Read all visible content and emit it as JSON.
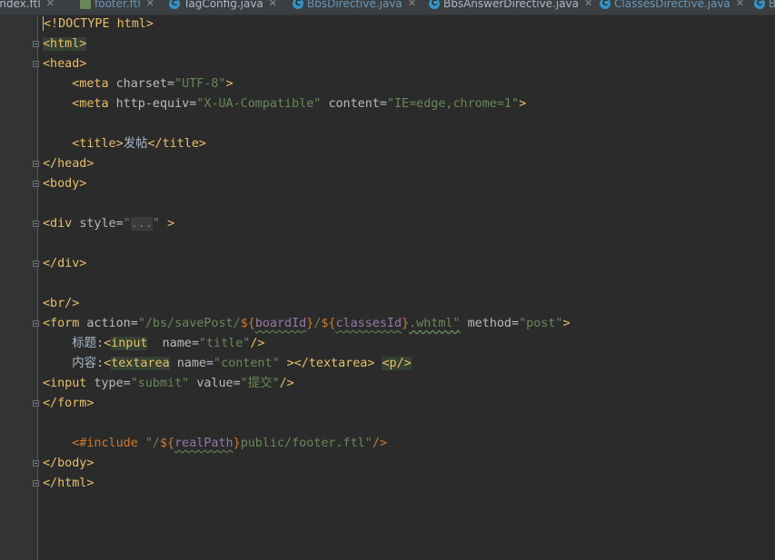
{
  "tabs": [
    {
      "label": "index.ftl",
      "icon": "ftl-file-icon"
    },
    {
      "label": "footer.ftl",
      "icon": "ftl-file-icon"
    },
    {
      "label": "TagConfig.java",
      "icon": "java-class-icon"
    },
    {
      "label": "BbsDirective.java",
      "icon": "java-class-icon"
    },
    {
      "label": "BbsAnswerDirective.java",
      "icon": "java-class-icon"
    },
    {
      "label": "ClassesDirective.java",
      "icon": "java-class-icon"
    },
    {
      "label": "B",
      "icon": "java-class-icon"
    }
  ],
  "code": {
    "l1_doctype": "<!DOCTYPE html>",
    "l2": "<html>",
    "l3": "<head>",
    "l4_meta": "<meta",
    "l4_attr": "charset=",
    "l4_val": "\"UTF-8\"",
    "l4_end": ">",
    "l5_meta": "<meta",
    "l5_attr1": "http-equiv=",
    "l5_val1": "\"X-UA-Compatible\"",
    "l5_attr2": "content=",
    "l5_val2": "\"IE=edge,chrome=1\"",
    "l5_end": ">",
    "l7_open": "<title>",
    "l7_text": "发帖",
    "l7_close": "</title>",
    "l8": "</head>",
    "l9": "<body>",
    "l11_div": "<div",
    "l11_attr": "style=",
    "l11_q1": "\"",
    "l11_dots": "...",
    "l11_q2": "\"",
    "l11_end": ">",
    "l13": "</div>",
    "l15": "<br/>",
    "l16_form": "<form",
    "l16_attr1": "action=",
    "l16_s1": "\"/bs/savePost/",
    "l16_d1": "${",
    "l16_v1": "boardId",
    "l16_d1c": "}",
    "l16_s2": "/",
    "l16_d2": "${",
    "l16_v2": "classesId",
    "l16_d2c": "}",
    "l16_s3": ".whtml\"",
    "l16_attr2": "method=",
    "l16_val2": "\"post\"",
    "l16_end": ">",
    "l17_text": "标题:",
    "l17_tagopen": "<",
    "l17_tagname": "input",
    "l17_attr": "name=",
    "l17_val": "\"title\"",
    "l17_end": "/>",
    "l18_text": "内容:",
    "l18_tagopen": "<",
    "l18_tagname": "textarea",
    "l18_attr": "name=",
    "l18_val": "\"content\"",
    "l18_close": "></textarea>",
    "l18_p": "<p/>",
    "l19_input": "<input",
    "l19_attr1": "type=",
    "l19_val1": "\"submit\"",
    "l19_attr2": "value=",
    "l19_val2": "\"提交\"",
    "l19_end": "/>",
    "l20": "</form>",
    "l22_inc": "<#include",
    "l22_s1": "\"/",
    "l22_d": "${",
    "l22_v": "realPath",
    "l22_dc": "}",
    "l22_s2": "public/footer.ftl\"",
    "l22_end": "/>",
    "l23": "</body>",
    "l24": "</html>"
  }
}
